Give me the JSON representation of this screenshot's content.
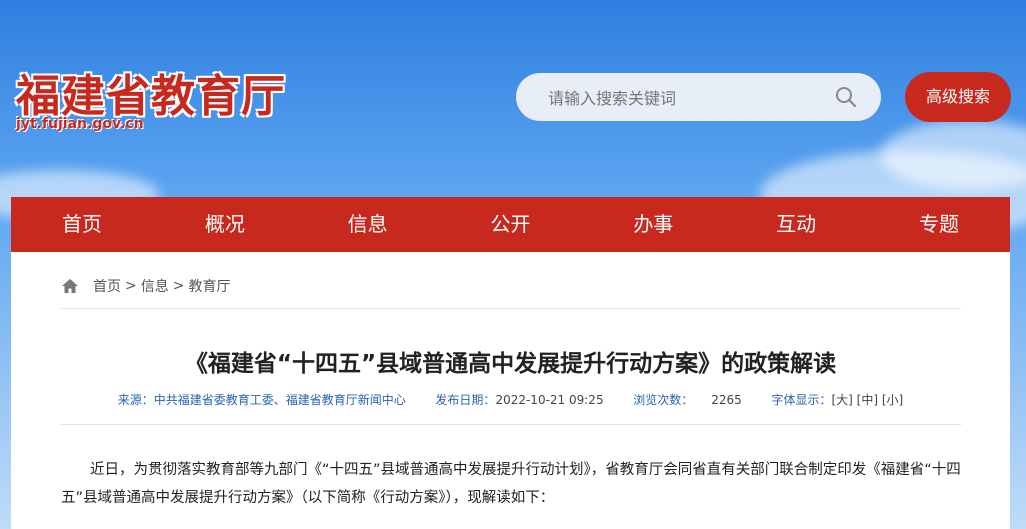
{
  "header": {
    "logo_cn": "福建省教育厅",
    "logo_en": "jyt.fujian.gov.cn",
    "search_placeholder": "请输入搜索关键词",
    "advanced_search": "高级搜索"
  },
  "nav": [
    "首页",
    "概况",
    "信息",
    "公开",
    "办事",
    "互动",
    "专题"
  ],
  "breadcrumb": [
    "首页",
    "信息",
    "教育厅"
  ],
  "article": {
    "title": "《福建省“十四五”县域普通高中发展提升行动方案》的政策解读",
    "source_label": "来源：",
    "source": "中共福建省委教育工委、福建省教育厅新闻中心",
    "date_label": "发布日期：",
    "date": "2022-10-21 09:25",
    "views_label": "浏览次数：",
    "views": "2265",
    "font_label": "字体显示：",
    "font_large": "[大]",
    "font_medium": "[中]",
    "font_small": "[小]",
    "body": "近日，为贯彻落实教育部等九部门《“十四五”县域普通高中发展提升行动计划》，省教育厅会同省直有关部门联合制定印发《福建省“十四五”县域普通高中发展提升行动方案》（以下简称《行动方案》），现解读如下："
  },
  "colors": {
    "brand_red": "#c8291f",
    "link_blue": "#2a64b0"
  },
  "icons": {
    "search": "search-icon",
    "home": "home-icon"
  }
}
